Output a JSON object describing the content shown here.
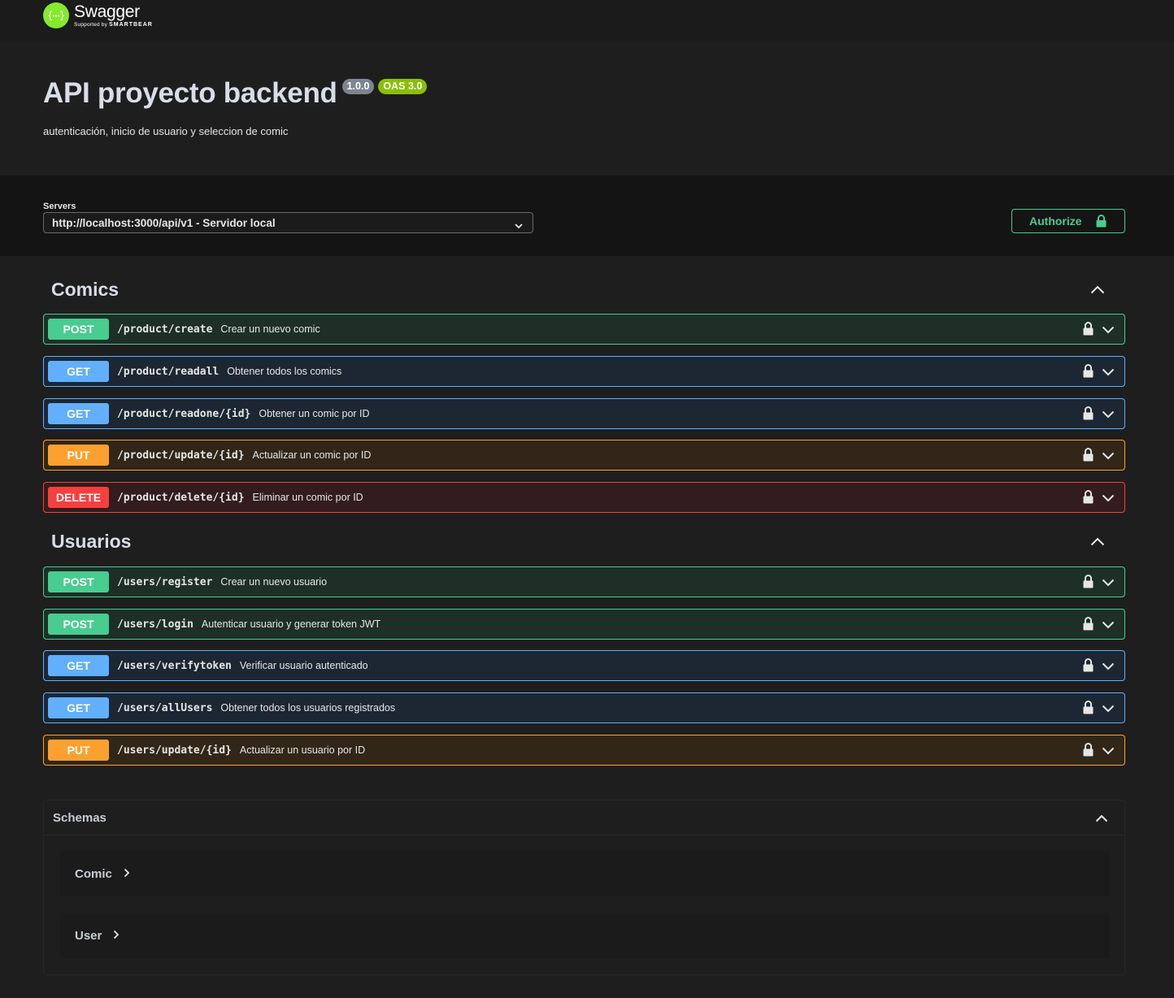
{
  "header": {
    "brand": "Swagger",
    "tagline_prefix": "Supported by",
    "tagline_brand": "SMARTBEAR"
  },
  "info": {
    "title": "API proyecto backend",
    "version": "1.0.0",
    "oas": "OAS 3.0",
    "description": "autenticación, inicio de usuario y seleccion de comic"
  },
  "servers": {
    "label": "Servers",
    "selected": "http://localhost:3000/api/v1 - Servidor local"
  },
  "authorize": {
    "label": "Authorize"
  },
  "tags": [
    {
      "name": "Comics",
      "operations": [
        {
          "method": "POST",
          "path": "/product/create",
          "summary": "Crear un nuevo comic"
        },
        {
          "method": "GET",
          "path": "/product/readall",
          "summary": "Obtener todos los comics"
        },
        {
          "method": "GET",
          "path": "/product/readone/{id}",
          "summary": "Obtener un comic por ID"
        },
        {
          "method": "PUT",
          "path": "/product/update/{id}",
          "summary": "Actualizar un comic por ID"
        },
        {
          "method": "DELETE",
          "path": "/product/delete/{id}",
          "summary": "Eliminar un comic por ID"
        }
      ]
    },
    {
      "name": "Usuarios",
      "operations": [
        {
          "method": "POST",
          "path": "/users/register",
          "summary": "Crear un nuevo usuario"
        },
        {
          "method": "POST",
          "path": "/users/login",
          "summary": "Autenticar usuario y generar token JWT"
        },
        {
          "method": "GET",
          "path": "/users/verifytoken",
          "summary": "Verificar usuario autenticado"
        },
        {
          "method": "GET",
          "path": "/users/allUsers",
          "summary": "Obtener todos los usuarios registrados"
        },
        {
          "method": "PUT",
          "path": "/users/update/{id}",
          "summary": "Actualizar un usuario por ID"
        }
      ]
    }
  ],
  "schemas": {
    "title": "Schemas",
    "items": [
      "Comic",
      "User"
    ]
  },
  "colors": {
    "post": "#49cc90",
    "get": "#61affe",
    "put": "#fca130",
    "delete": "#f93e3e",
    "brand": "#85ea2d"
  }
}
